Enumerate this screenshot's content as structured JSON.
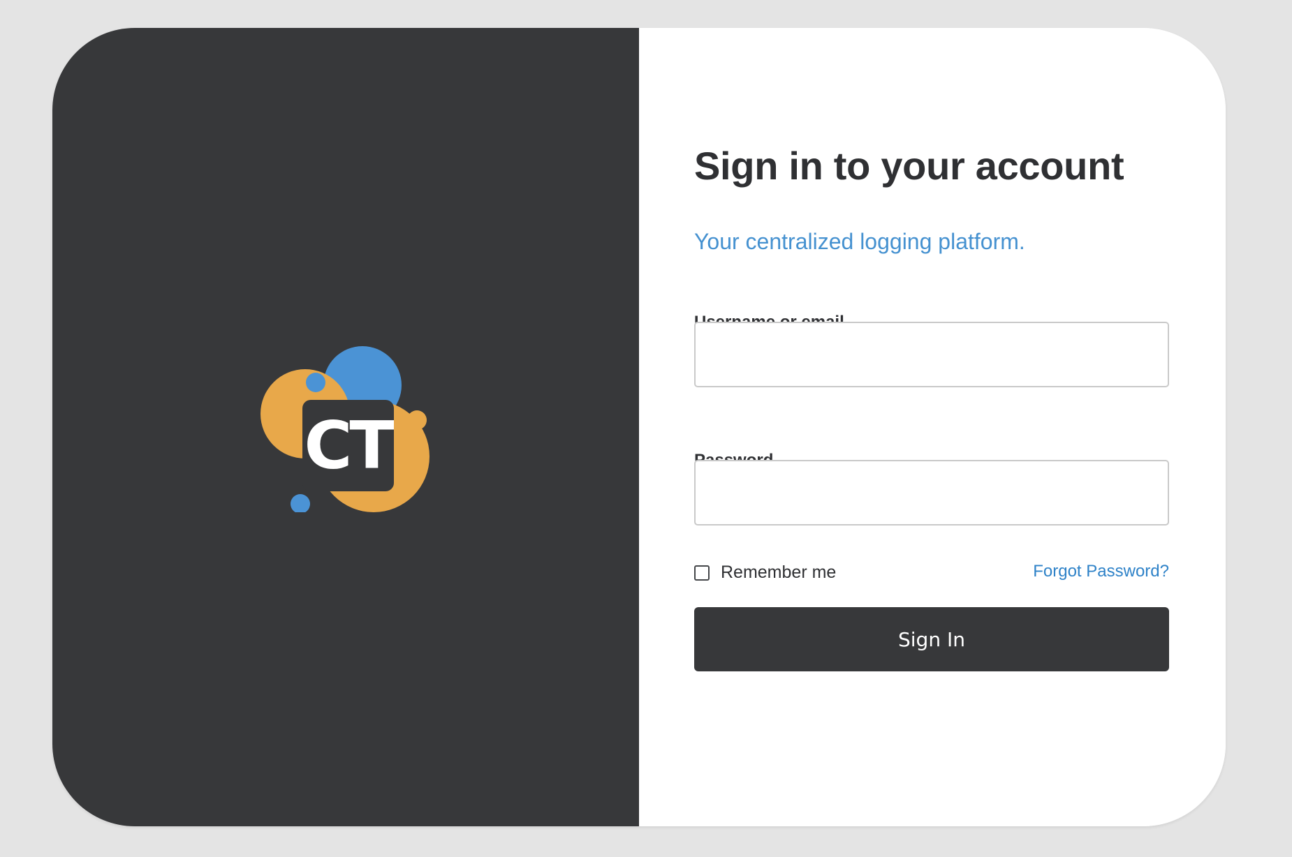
{
  "brand": {
    "logo_text": "CT",
    "logo_icon": "ct-bubbles-logo",
    "colors": {
      "panel": "#37383a",
      "orange": "#e8a84a",
      "blue": "#4b93d5",
      "tile": "#37383a"
    }
  },
  "form": {
    "title": "Sign in to your account",
    "subtitle": "Your centralized logging platform.",
    "username_label": "Username or email",
    "username_value": "",
    "password_label": "Password",
    "password_value": "",
    "remember_label": "Remember me",
    "remember_checked": false,
    "forgot_label": "Forgot Password?",
    "submit_label": "Sign In"
  },
  "theme": {
    "page_background": "#e4e4e4",
    "accent": "#4591d0",
    "link": "#2e82c8",
    "text": "#2f3033"
  }
}
